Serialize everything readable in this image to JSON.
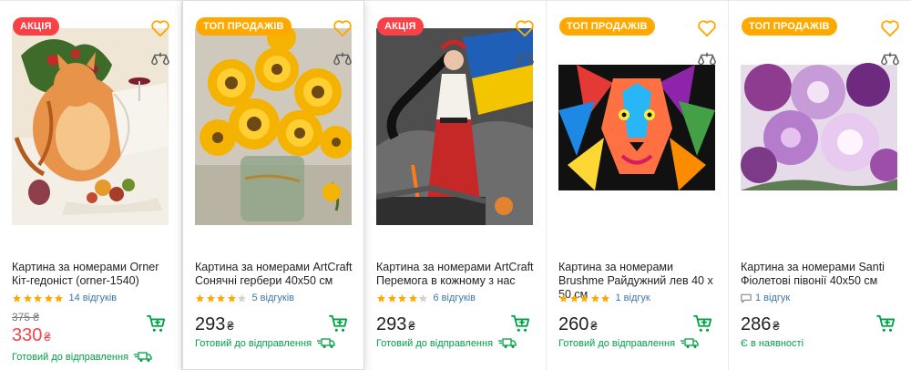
{
  "colors": {
    "sale": "#f84147",
    "top": "#ffa900",
    "green": "#00a046",
    "link": "#3e77aa",
    "star": "#ffa900"
  },
  "products": [
    {
      "badge": "АКЦІЯ",
      "badge_type": "sale",
      "title": "Картина за номерами Orner Кіт-гедоніст (orner-1540)",
      "rating": 5,
      "reviews": "14 відгуків",
      "old_price": "375 ₴",
      "price": "330",
      "currency": "₴",
      "status": "Готовий до відправлення",
      "image": "cat-painting"
    },
    {
      "badge": "ТОП ПРОДАЖІВ",
      "badge_type": "top",
      "title": "Картина за номерами ArtCraft Сонячні гербери 40х50 см",
      "rating": 4,
      "reviews": "5 відгуків",
      "old_price": "",
      "price": "293",
      "currency": "₴",
      "status": "Готовий до відправлення",
      "image": "sunflowers-painting"
    },
    {
      "badge": "АКЦІЯ",
      "badge_type": "sale",
      "title": "Картина за номерами ArtCraft Перемога в кожному з нас",
      "rating": 4,
      "reviews": "6 відгуків",
      "old_price": "",
      "price": "293",
      "currency": "₴",
      "status": "Готовий до відправлення",
      "image": "victory-painting"
    },
    {
      "badge": "ТОП ПРОДАЖІВ",
      "badge_type": "top",
      "title": "Картина за номерами Brushme Райдужний лев 40 х 50 см",
      "rating": 5,
      "reviews": "1 відгук",
      "old_price": "",
      "price": "260",
      "currency": "₴",
      "status": "Готовий до відправлення",
      "image": "lion-painting"
    },
    {
      "badge": "ТОП ПРОДАЖІВ",
      "badge_type": "top",
      "title": "Картина за номерами Santi Фіолетові півонії 40х50 см",
      "rating": 0,
      "reviews": "1 відгук",
      "old_price": "",
      "price": "286",
      "currency": "₴",
      "status": "Є в наявності",
      "image": "peonies-painting"
    }
  ]
}
